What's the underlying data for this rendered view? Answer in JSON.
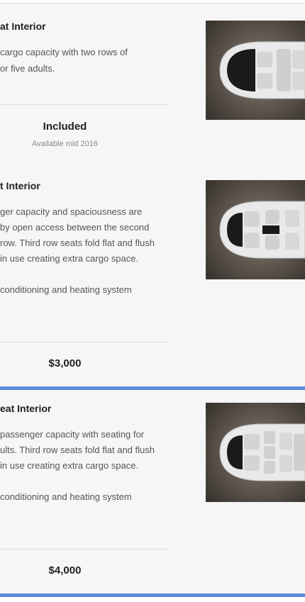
{
  "options": [
    {
      "title": "at Interior",
      "description": [
        " cargo capacity with two rows of",
        "or five adults."
      ],
      "price": "Included",
      "availability": "Available mid 2016",
      "image_icon": "car-interior-five-seat-icon",
      "selected": false
    },
    {
      "title": "t Interior",
      "description": [
        "ger capacity and spaciousness are",
        " by open access between the second",
        "row. Third row seats fold flat and flush",
        " in use creating extra cargo space.",
        "",
        "conditioning and heating system"
      ],
      "price": "$3,000",
      "image_icon": "car-interior-six-seat-icon",
      "selected": true
    },
    {
      "title": "eat Interior",
      "description": [
        " passenger capacity with seating for",
        "ults. Third row seats fold flat and flush",
        " in use creating extra cargo space.",
        "",
        "conditioning and heating system"
      ],
      "price": "$4,000",
      "image_icon": "car-interior-seven-seat-icon",
      "selected": true
    }
  ],
  "colors": {
    "selected_border": "#5b8dd9",
    "card_background": "#f6f6f6"
  }
}
